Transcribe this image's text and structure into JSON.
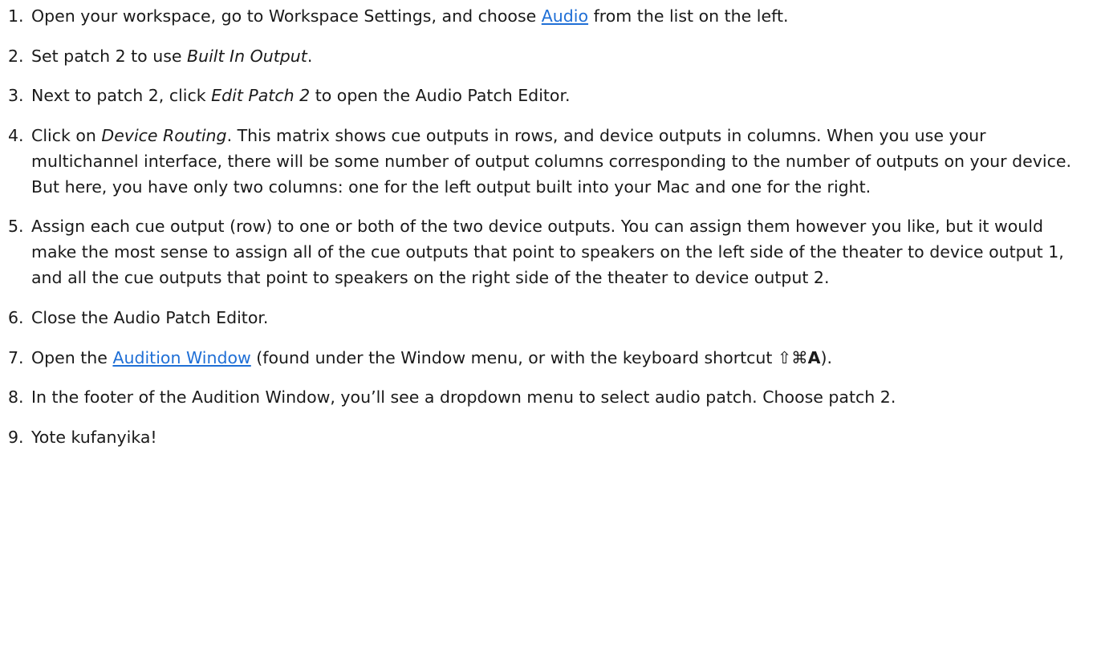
{
  "steps": [
    {
      "num": "1.",
      "before": "Open your workspace, go to Workspace Settings, and choose ",
      "link": "Audio",
      "after": " from the list on the left."
    },
    {
      "num": "2.",
      "before": "Set patch 2 to use ",
      "em": "Built In Output",
      "after": "."
    },
    {
      "num": "3.",
      "before": "Next to patch 2, click ",
      "em": "Edit Patch 2",
      "after": " to open the Audio Patch Editor."
    },
    {
      "num": "4.",
      "before": "Click on ",
      "em": "Device Routing",
      "after": ". This matrix shows cue outputs in rows, and device outputs in columns. When you use your multichannel interface, there will be some number of output columns corresponding to the number of outputs on your device. But here, you have only two columns: one for the left output built into your Mac and one for the right."
    },
    {
      "num": "5.",
      "text": "Assign each cue output (row) to one or both of the two device outputs. You can assign them however you like, but it would make the most sense to assign all of the cue outputs that point to speakers on the left side of the theater to device output 1, and all the cue outputs that point to speakers on the right side of the theater to device output 2."
    },
    {
      "num": "6.",
      "text": "Close the Audio Patch Editor."
    },
    {
      "num": "7.",
      "before": "Open the ",
      "link": "Audition Window",
      "middle": " (found under the Window menu, or with the keyboard shortcut ",
      "shortcut_symbols": "⇧⌘",
      "shortcut_key": "A",
      "after": ")."
    },
    {
      "num": "8.",
      "text": "In the footer of the Audition Window, you’ll see a dropdown menu to select audio patch. Choose patch 2."
    },
    {
      "num": "9.",
      "text": "Yote kufanyika!"
    }
  ],
  "colors": {
    "link": "#1f6fd6",
    "text": "#1a1a1a"
  }
}
